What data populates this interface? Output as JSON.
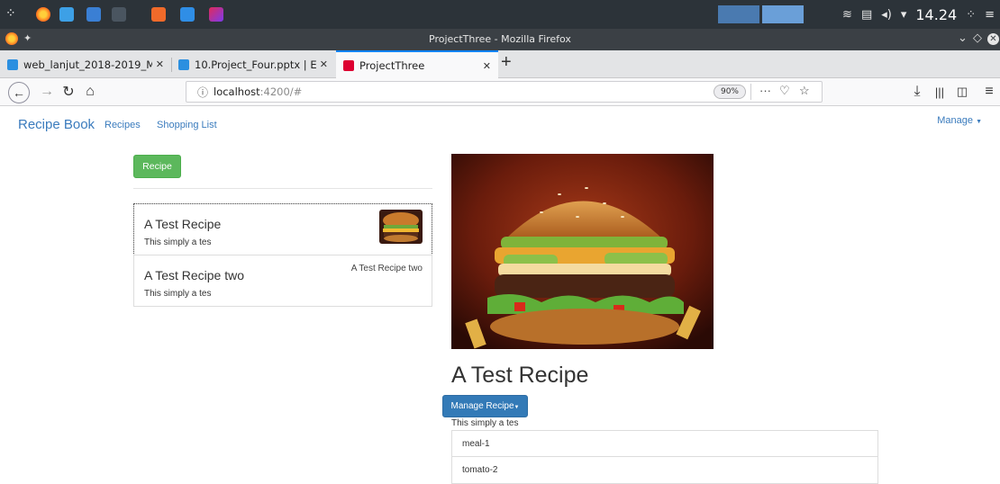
{
  "browser": {
    "window_title": "ProjectThree - Mozilla Firefox",
    "clock": "14.24",
    "tabs": [
      {
        "label": "web_lanjut_2018-2019_MI",
        "close": "✕"
      },
      {
        "label": "10.Project_Four.pptx | Edr",
        "close": "✕"
      },
      {
        "label": "ProjectThree",
        "close": "✕"
      }
    ],
    "new_tab": "+",
    "url_host": "localhost",
    "url_path": ":4200/#",
    "zoom": "90%",
    "accent": "#0a84ff"
  },
  "app": {
    "brand": "Recipe Book",
    "nav": {
      "recipes": "Recipes",
      "shopping_list": "Shopping List"
    },
    "manage_menu": "Manage"
  },
  "recipe_list": {
    "new_button": "Recipe",
    "items": [
      {
        "name": "A Test Recipe",
        "description": "This simply a tes",
        "image_alt": ""
      },
      {
        "name": "A Test Recipe two",
        "description": "This simply a tes",
        "image_alt": "A Test Recipe two"
      }
    ]
  },
  "detail": {
    "title": "A Test Recipe",
    "manage_button": "Manage Recipe",
    "description": "This simply a tes",
    "ingredients": [
      "meal-1",
      "tomato-2"
    ]
  },
  "colors": {
    "link": "#3a7bbd",
    "success": "#5cb85c",
    "primary": "#337ab7"
  }
}
